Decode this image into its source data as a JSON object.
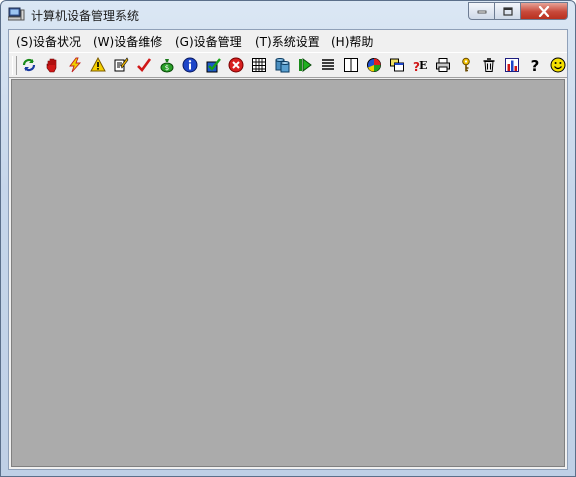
{
  "window": {
    "title": "计算机设备管理系统"
  },
  "menu": [
    {
      "label": "(S)设备状况",
      "accel": "S"
    },
    {
      "label": "(W)设备维修",
      "accel": "W"
    },
    {
      "label": "(G)设备管理",
      "accel": "G"
    },
    {
      "label": "(T)系统设置",
      "accel": "T"
    },
    {
      "label": "(H)帮助",
      "accel": "H"
    }
  ],
  "toolbar": {
    "icons": [
      "refresh-icon",
      "stop-hand-icon",
      "lightning-icon",
      "warning-icon",
      "edit-note-icon",
      "checkmark-icon",
      "money-bag-icon",
      "info-icon",
      "task-check-icon",
      "cancel-icon",
      "grid-icon",
      "database-icon",
      "run-next-icon",
      "list-icon",
      "columns-icon",
      "pie-chart-icon",
      "copy-windows-icon",
      "help-text-icon",
      "printer-icon",
      "key-icon",
      "trash-icon",
      "bar-chart-icon",
      "question-icon",
      "smiley-icon"
    ]
  },
  "colors": {
    "workspace": "#ababab",
    "close_button": "#c8493a"
  }
}
